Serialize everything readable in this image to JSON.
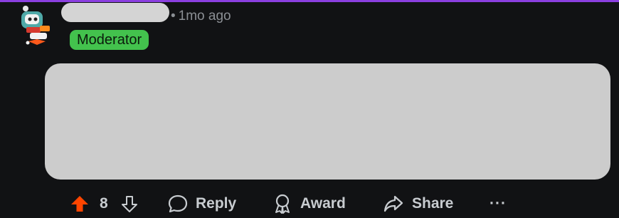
{
  "comment": {
    "time": "1mo ago",
    "badge": "Moderator",
    "separator": "•",
    "votes": "8"
  },
  "actions": {
    "reply_label": "Reply",
    "award_label": "Award",
    "share_label": "Share",
    "more_label": "···"
  },
  "colors": {
    "accent": "#8b3fe0",
    "background": "#111214",
    "moderator_badge": "#43c24d",
    "upvote": "#ff4500",
    "muted_text": "#8b8f94"
  },
  "icons": {
    "upvote": "upvote-arrow-icon",
    "downvote": "downvote-arrow-icon",
    "reply": "speech-bubble-icon",
    "award": "award-ribbon-icon",
    "share": "share-arrow-icon"
  }
}
